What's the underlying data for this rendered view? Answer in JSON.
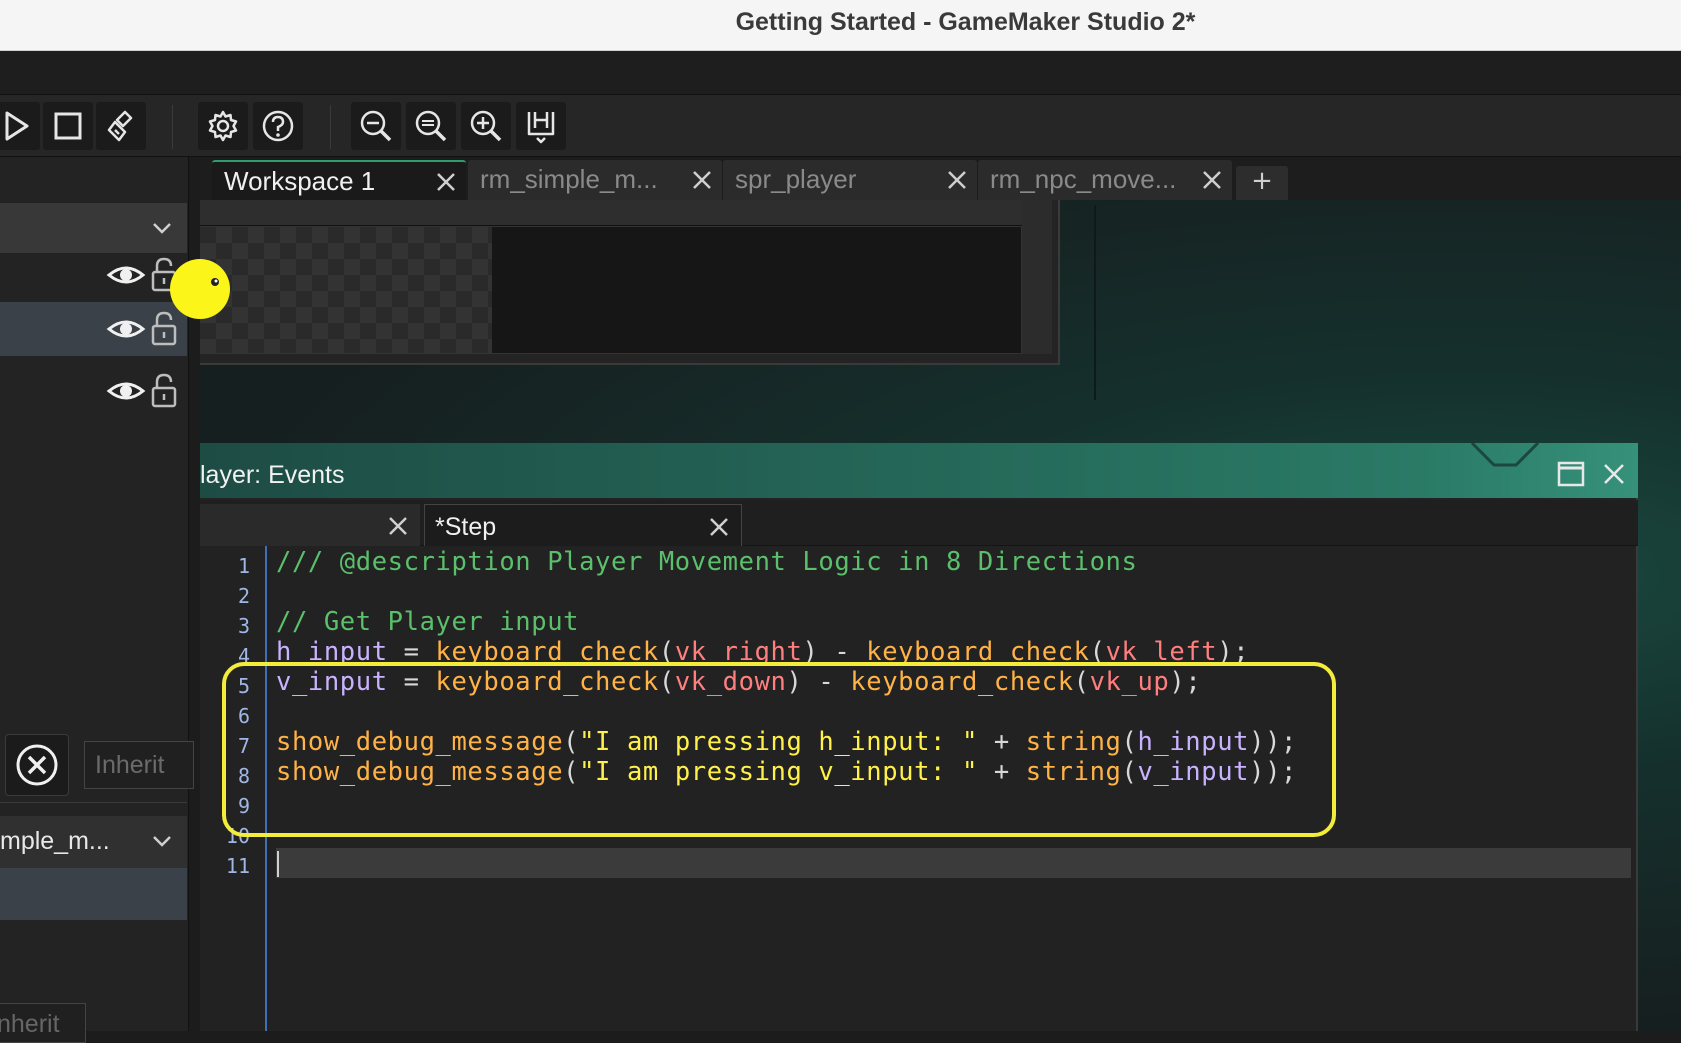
{
  "window": {
    "title": "Getting Started - GameMaker Studio 2*"
  },
  "toolbar": {
    "buttons": [
      {
        "name": "run-button",
        "icon": "play-icon"
      },
      {
        "name": "stop-button",
        "icon": "stop-icon"
      },
      {
        "name": "clean-button",
        "icon": "brush-icon"
      },
      {
        "name": "preferences-button",
        "icon": "gear-icon"
      },
      {
        "name": "help-button",
        "icon": "help-icon"
      },
      {
        "name": "zoom-out-button",
        "icon": "zoom-out-icon"
      },
      {
        "name": "zoom-reset-button",
        "icon": "zoom-reset-icon"
      },
      {
        "name": "zoom-in-button",
        "icon": "zoom-in-icon"
      },
      {
        "name": "fit-button",
        "icon": "fit-icon"
      }
    ]
  },
  "workspace_tabs": [
    {
      "label": "Workspace 1",
      "active": true
    },
    {
      "label": "rm_simple_m...",
      "active": false
    },
    {
      "label": "spr_player",
      "active": false
    },
    {
      "label": "rm_npc_move...",
      "active": false
    }
  ],
  "workspace_add_label": "+",
  "left_panel": {
    "inherit_placeholder": "Inherit",
    "room_dropdown_value": "mple_m...",
    "inherit_placeholder_2": "nherit"
  },
  "events_window": {
    "title": "layer: Events",
    "tabs": [
      {
        "label": "",
        "active": false
      },
      {
        "label": "*Step",
        "active": true
      }
    ]
  },
  "code": {
    "line_numbers": [
      "1",
      "2",
      "3",
      "4",
      "5",
      "6",
      "7",
      "8",
      "9",
      "10",
      "11"
    ],
    "lines": [
      "/// @description Player Movement Logic in 8 Directions",
      "",
      "// Get Player input",
      "h_input = keyboard_check(vk_right) - keyboard_check(vk_left);",
      "v_input = keyboard_check(vk_down) - keyboard_check(vk_up);",
      "",
      "show_debug_message(\"I am pressing h_input: \" + string(h_input));",
      "show_debug_message(\"I am pressing v_input: \" + string(v_input));",
      "",
      "",
      ""
    ],
    "highlight_color": "#f4ec3a"
  },
  "colors": {
    "accent": "#2f9c6f",
    "comment": "#5bbf6b",
    "variable": "#c9b2ff",
    "function": "#ffb347",
    "constant": "#ff7f7f",
    "string": "#fff04a"
  }
}
